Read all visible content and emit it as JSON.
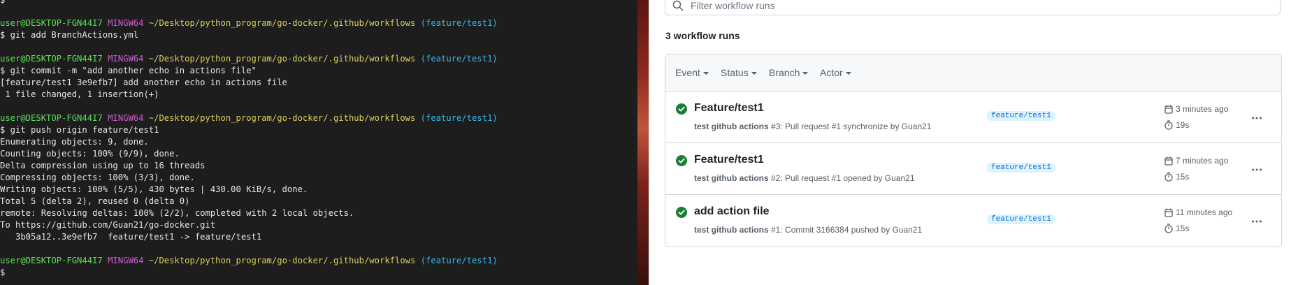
{
  "terminal": {
    "lines": [
      {
        "segments": [
          {
            "cls": "c-text",
            "text": "$"
          }
        ]
      },
      {
        "segments": [
          {
            "cls": "c-user",
            "text": "user@DESKTOP-FGN44I7 "
          },
          {
            "cls": "c-host",
            "text": "MINGW64 "
          },
          {
            "cls": "c-path",
            "text": "~/Desktop/python_program/go-docker/.github/workflows "
          },
          {
            "cls": "c-branch",
            "text": "(feature/test1)"
          }
        ]
      },
      {
        "segments": [
          {
            "cls": "c-text",
            "text": "$ git add BranchActions.yml"
          }
        ]
      },
      {
        "segments": [
          {
            "cls": "c-text",
            "text": ""
          }
        ]
      },
      {
        "segments": [
          {
            "cls": "c-user",
            "text": "user@DESKTOP-FGN44I7 "
          },
          {
            "cls": "c-host",
            "text": "MINGW64 "
          },
          {
            "cls": "c-path",
            "text": "~/Desktop/python_program/go-docker/.github/workflows "
          },
          {
            "cls": "c-branch",
            "text": "(feature/test1)"
          }
        ]
      },
      {
        "segments": [
          {
            "cls": "c-text",
            "text": "$ git commit -m \"add another echo in actions file\""
          }
        ]
      },
      {
        "segments": [
          {
            "cls": "c-text",
            "text": "[feature/test1 3e9efb7] add another echo in actions file"
          }
        ]
      },
      {
        "segments": [
          {
            "cls": "c-text",
            "text": " 1 file changed, 1 insertion(+)"
          }
        ]
      },
      {
        "segments": [
          {
            "cls": "c-text",
            "text": ""
          }
        ]
      },
      {
        "segments": [
          {
            "cls": "c-user",
            "text": "user@DESKTOP-FGN44I7 "
          },
          {
            "cls": "c-host",
            "text": "MINGW64 "
          },
          {
            "cls": "c-path",
            "text": "~/Desktop/python_program/go-docker/.github/workflows "
          },
          {
            "cls": "c-branch",
            "text": "(feature/test1)"
          }
        ]
      },
      {
        "segments": [
          {
            "cls": "c-text",
            "text": "$ git push origin feature/test1"
          }
        ]
      },
      {
        "segments": [
          {
            "cls": "c-text",
            "text": "Enumerating objects: 9, done."
          }
        ]
      },
      {
        "segments": [
          {
            "cls": "c-text",
            "text": "Counting objects: 100% (9/9), done."
          }
        ]
      },
      {
        "segments": [
          {
            "cls": "c-text",
            "text": "Delta compression using up to 16 threads"
          }
        ]
      },
      {
        "segments": [
          {
            "cls": "c-text",
            "text": "Compressing objects: 100% (3/3), done."
          }
        ]
      },
      {
        "segments": [
          {
            "cls": "c-text",
            "text": "Writing objects: 100% (5/5), 430 bytes | 430.00 KiB/s, done."
          }
        ]
      },
      {
        "segments": [
          {
            "cls": "c-text",
            "text": "Total 5 (delta 2), reused 0 (delta 0)"
          }
        ]
      },
      {
        "segments": [
          {
            "cls": "c-text",
            "text": "remote: Resolving deltas: 100% (2/2), completed with 2 local objects."
          }
        ]
      },
      {
        "segments": [
          {
            "cls": "c-text",
            "text": "To https://github.com/Guan21/go-docker.git"
          }
        ]
      },
      {
        "segments": [
          {
            "cls": "c-text",
            "text": "   3b05a12..3e9efb7  feature/test1 -> feature/test1"
          }
        ]
      },
      {
        "segments": [
          {
            "cls": "c-text",
            "text": ""
          }
        ]
      },
      {
        "segments": [
          {
            "cls": "c-user",
            "text": "user@DESKTOP-FGN44I7 "
          },
          {
            "cls": "c-host",
            "text": "MINGW64 "
          },
          {
            "cls": "c-path",
            "text": "~/Desktop/python_program/go-docker/.github/workflows "
          },
          {
            "cls": "c-branch",
            "text": "(feature/test1)"
          }
        ]
      },
      {
        "segments": [
          {
            "cls": "c-text",
            "text": "$"
          }
        ]
      }
    ]
  },
  "github": {
    "filter": {
      "placeholder": "Filter workflow runs"
    },
    "runs_count": "3 workflow runs",
    "header": {
      "event": "Event",
      "status": "Status",
      "branch": "Branch",
      "actor": "Actor"
    },
    "runs": [
      {
        "title": "Feature/test1",
        "workflow": "test github actions",
        "detail": " #3: Pull request #1 synchronize by Guan21",
        "branch": "feature/test1",
        "time": "3 minutes ago",
        "duration": "19s"
      },
      {
        "title": "Feature/test1",
        "workflow": "test github actions",
        "detail": " #2: Pull request #1 opened by Guan21",
        "branch": "feature/test1",
        "time": "7 minutes ago",
        "duration": "15s"
      },
      {
        "title": "add action file",
        "workflow": "test github actions",
        "detail": " #1: Commit 3166384 pushed by Guan21",
        "branch": "feature/test1",
        "time": "11 minutes ago",
        "duration": "15s"
      }
    ]
  },
  "colors": {
    "success": "#1a7f37",
    "branch_bg": "#ddf4ff",
    "branch_fg": "#0969da"
  }
}
